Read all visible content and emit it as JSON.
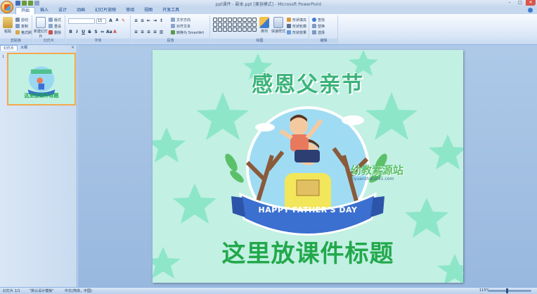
{
  "window": {
    "title": "ppt课件 - 副本.ppt [兼容模式] - Microsoft PowerPoint",
    "controls": [
      "–",
      "□",
      "✕"
    ]
  },
  "ribbon": {
    "tabs": [
      "开始",
      "插入",
      "设计",
      "动画",
      "幻灯片放映",
      "审阅",
      "视图",
      "开发工具"
    ],
    "active_tab": "开始",
    "clipboard": {
      "label": "剪贴板",
      "paste": "粘贴",
      "cut": "剪切",
      "copy": "复制",
      "format_painter": "格式刷"
    },
    "slides": {
      "label": "幻灯片",
      "new_slide": "新建幻灯片",
      "layout": "版式",
      "reset": "重设",
      "delete": "删除"
    },
    "font": {
      "label": "字体",
      "font_name": "",
      "font_size": "15"
    },
    "paragraph": {
      "label": "段落",
      "text_direction": "文字方向",
      "align_text": "对齐文本",
      "smartart": "转换为 SmartArt"
    },
    "drawing": {
      "label": "绘图",
      "arrange": "排列",
      "quick_styles": "快速样式",
      "fill": "形状填充",
      "outline": "形状轮廓",
      "effects": "形状效果"
    },
    "editing": {
      "label": "编辑",
      "find": "查找",
      "replace": "替换",
      "select": "选择"
    }
  },
  "panel": {
    "tabs": [
      "幻灯片",
      "大纲"
    ],
    "close": "×",
    "slide_number": "1"
  },
  "slide": {
    "heading_art": "感恩父亲节",
    "banner": "HAPPY FATHER'S DAY",
    "watermark": "幼教素源站",
    "watermark_url": "ziyuanzhanzi41.com",
    "title": "这里放课件标题"
  },
  "status": {
    "slide_counter": "幻灯片 1/1",
    "theme": "\"默认设计模板\"",
    "language": "中文(简体，中国)",
    "zoom": "115%"
  },
  "colors": {
    "slide_bg": "#c2f0e3",
    "star": "#8de6c8",
    "title_green": "#22a84b",
    "banner_blue": "#3b6fd0"
  }
}
